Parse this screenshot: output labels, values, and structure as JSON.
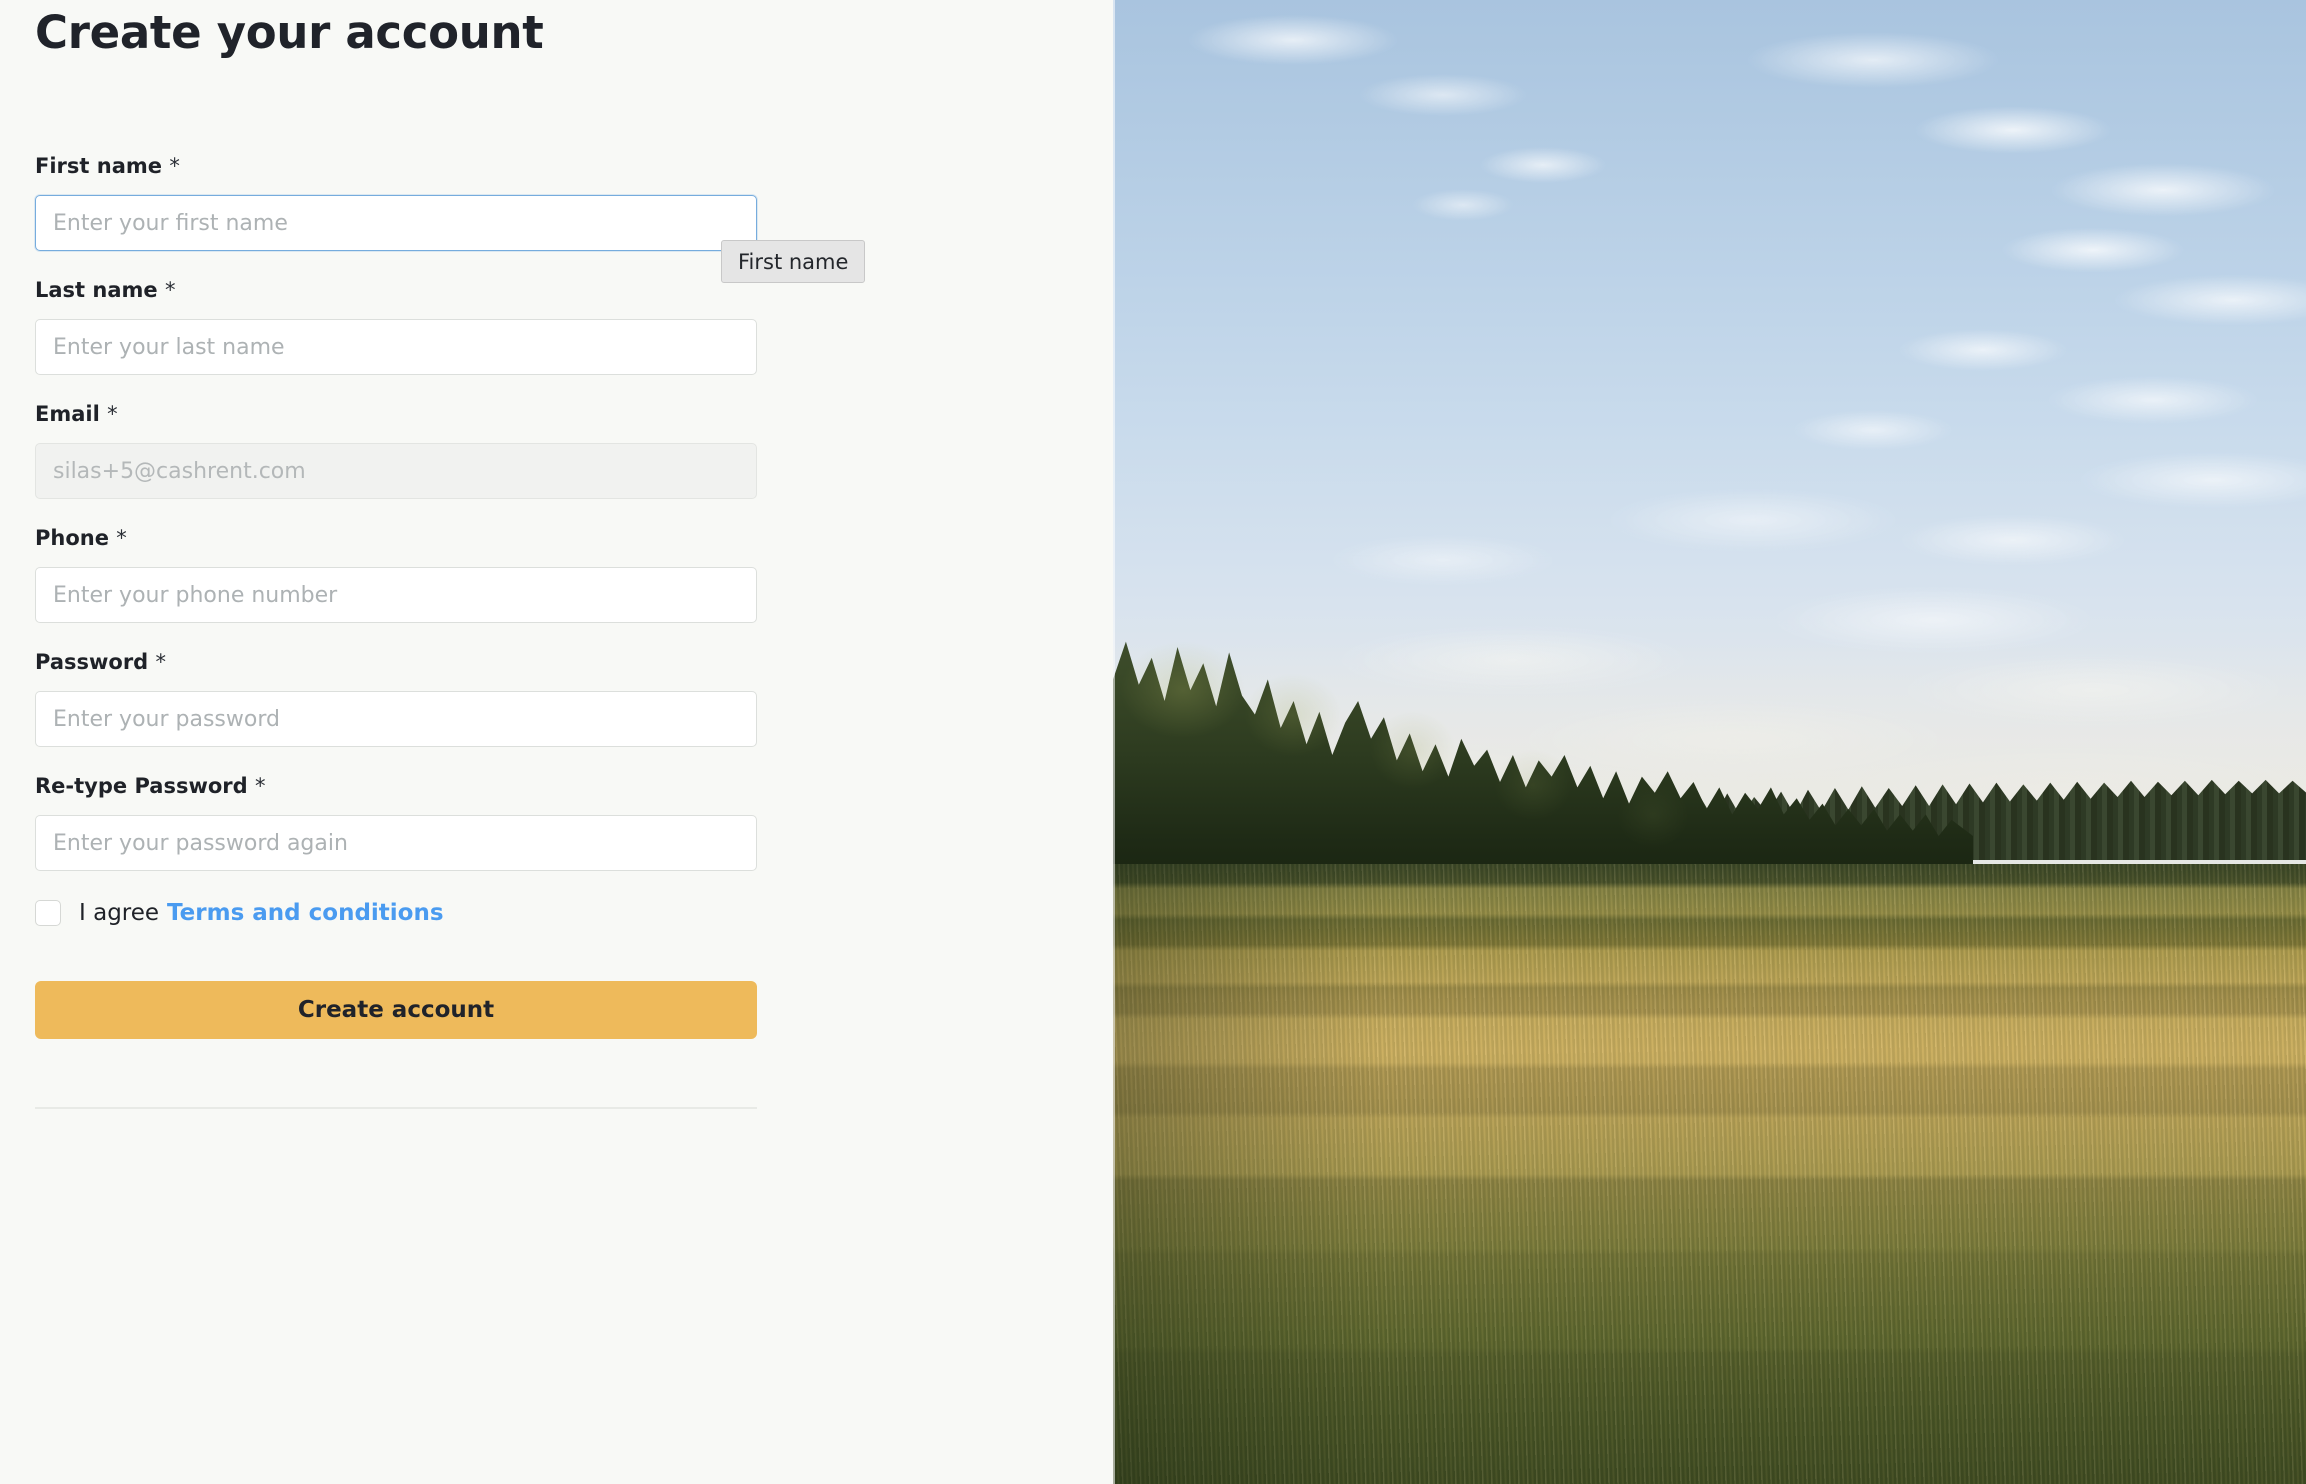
{
  "page": {
    "title": "Create your account"
  },
  "tooltip": {
    "text": "First name"
  },
  "form": {
    "required_marker": "*",
    "fields": [
      {
        "label": "First name",
        "placeholder": "Enter your first name",
        "value": "",
        "required": true,
        "state": "focused",
        "type": "text"
      },
      {
        "label": "Last name",
        "placeholder": "Enter your last name",
        "value": "",
        "required": true,
        "state": "default",
        "type": "text"
      },
      {
        "label": "Email",
        "placeholder": "silas+5@cashrent.com",
        "value": "",
        "required": true,
        "state": "disabled",
        "type": "email"
      },
      {
        "label": "Phone",
        "placeholder": "Enter your phone number",
        "value": "",
        "required": true,
        "state": "default",
        "type": "tel"
      },
      {
        "label": "Password",
        "placeholder": "Enter your password",
        "value": "",
        "required": true,
        "state": "default",
        "type": "password"
      },
      {
        "label": "Re-type Password",
        "placeholder": "Enter your password again",
        "value": "",
        "required": true,
        "state": "default",
        "type": "password"
      }
    ],
    "agree": {
      "checked": false,
      "text": "I agree",
      "link_text": "Terms and conditions"
    },
    "submit_label": "Create account"
  },
  "photo": {
    "description": "Sunset wheat field with treeline under cloudy blue sky"
  },
  "colors": {
    "panel_background": "#f8f9f6",
    "accent_button": "#eeba5b",
    "link_blue": "#4a9bf0",
    "focus_border": "#76acdd",
    "input_border": "#dcdfdc",
    "text_primary": "#1f2228",
    "placeholder": "#adb2b4",
    "tooltip_background": "#e5e5e5"
  }
}
